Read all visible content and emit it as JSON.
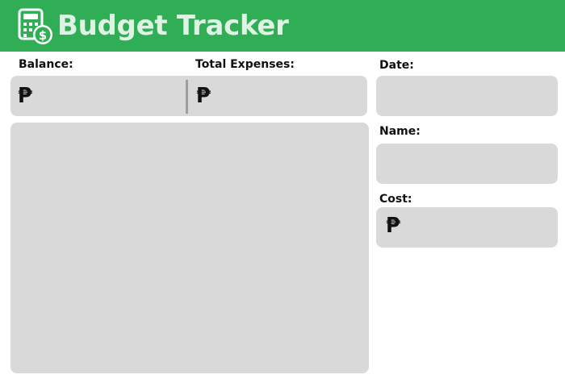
{
  "header": {
    "title": "Budget Tracker",
    "icon": "calculator-dollar-icon",
    "background_color": "#2fae55",
    "title_color": "#dff3e4"
  },
  "summary": {
    "balance_label": "Balance:",
    "balance_currency": "₱",
    "balance_value": "",
    "expenses_label": "Total Expenses:",
    "expenses_currency": "₱",
    "expenses_value": ""
  },
  "expense_list": {
    "items": []
  },
  "form": {
    "date_label": "Date:",
    "date_value": "",
    "name_label": "Name:",
    "name_value": "",
    "cost_label": "Cost:",
    "cost_currency": "₱",
    "cost_value": ""
  },
  "colors": {
    "field_background": "#d9d9d9",
    "divider": "#9e9e9e"
  }
}
